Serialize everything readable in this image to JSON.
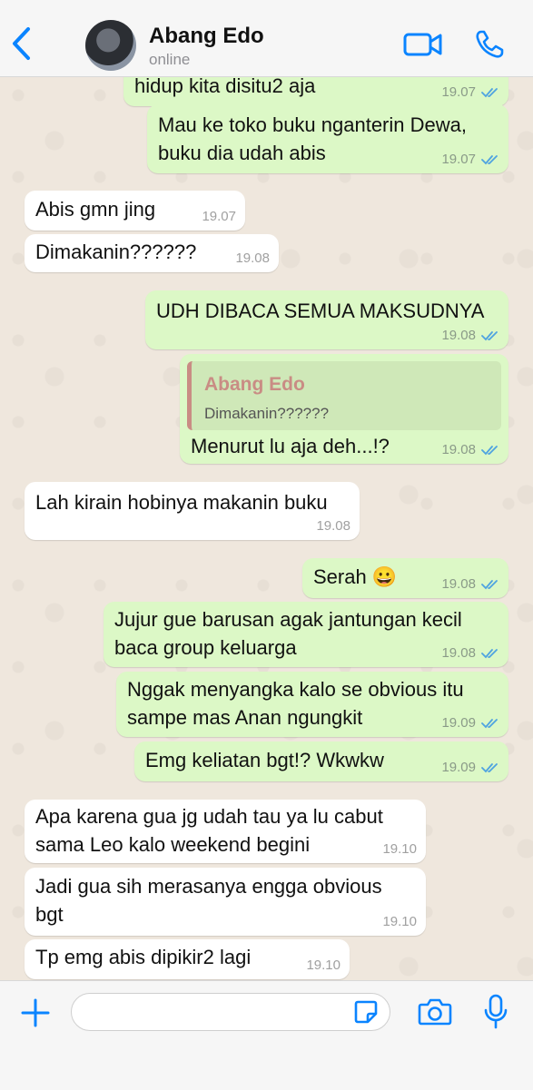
{
  "header": {
    "name": "Abang Edo",
    "status": "online"
  },
  "messages": [
    {
      "dir": "out",
      "text": "hidup kita disitu2 aja",
      "time": "19.07",
      "read": true
    },
    {
      "dir": "out",
      "text": "Mau ke toko buku nganterin Dewa,\nbuku dia udah abis",
      "time": "19.07",
      "read": true
    },
    {
      "dir": "in",
      "text": "Abis gmn jing",
      "time": "19.07"
    },
    {
      "dir": "in",
      "text": "Dimakanin??????",
      "time": "19.08"
    },
    {
      "dir": "out",
      "text": "UDH DIBACA SEMUA MAKSUDNYA",
      "time": "19.08",
      "read": true
    },
    {
      "dir": "out",
      "quote_name": "Abang Edo",
      "quote_text": "Dimakanin??????",
      "text": "Menurut lu aja deh...!?",
      "time": "19.08",
      "read": true
    },
    {
      "dir": "in",
      "text": "Lah kirain hobinya makanin buku",
      "time": "19.08"
    },
    {
      "dir": "out",
      "text": "Serah 😀",
      "time": "19.08",
      "read": true
    },
    {
      "dir": "out",
      "text": "Jujur gue barusan agak jantungan kecil\nbaca group keluarga",
      "time": "19.08",
      "read": true
    },
    {
      "dir": "out",
      "text": "Nggak menyangka kalo se obvious itu\nsampe mas Anan ngungkit",
      "time": "19.09",
      "read": true
    },
    {
      "dir": "out",
      "text": "Emg keliatan bgt!? Wkwkw",
      "time": "19.09",
      "read": true
    },
    {
      "dir": "in",
      "text": "Apa karena gua jg udah tau ya lu cabut\nsama Leo kalo weekend begini",
      "time": "19.10"
    },
    {
      "dir": "in",
      "text": "Jadi gua sih merasanya engga obvious\nbgt",
      "time": "19.10"
    },
    {
      "dir": "in",
      "text": "Tp emg abis dipikir2 lagi",
      "time": "19.10"
    }
  ],
  "composer": {
    "placeholder": ""
  },
  "colors": {
    "accent": "#0a84ff",
    "outgoing": "#dcf8c6",
    "incoming": "#ffffff",
    "read_ticks": "#4fa3e0"
  }
}
